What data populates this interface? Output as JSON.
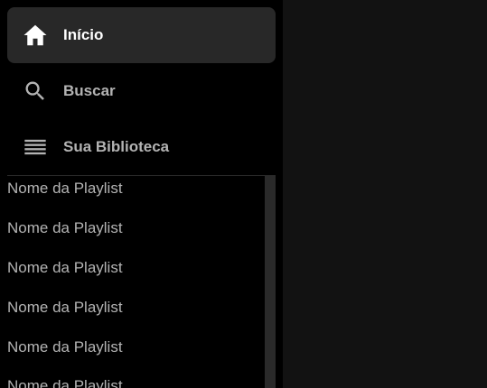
{
  "sidebar": {
    "nav": [
      {
        "label": "Início",
        "icon": "home-icon",
        "active": true
      },
      {
        "label": "Buscar",
        "icon": "search-icon",
        "active": false
      },
      {
        "label": "Sua Biblioteca",
        "icon": "library-icon",
        "active": false
      }
    ],
    "playlists": [
      "Nome da Playlist",
      "Nome da Playlist",
      "Nome da Playlist",
      "Nome da Playlist",
      "Nome da Playlist",
      "Nome da Playlist"
    ]
  },
  "colors": {
    "sidebar_bg": "#000000",
    "main_bg": "#121212",
    "active_item_bg": "#282828",
    "active_text": "#ffffff",
    "inactive_text": "#b3b3b3"
  }
}
